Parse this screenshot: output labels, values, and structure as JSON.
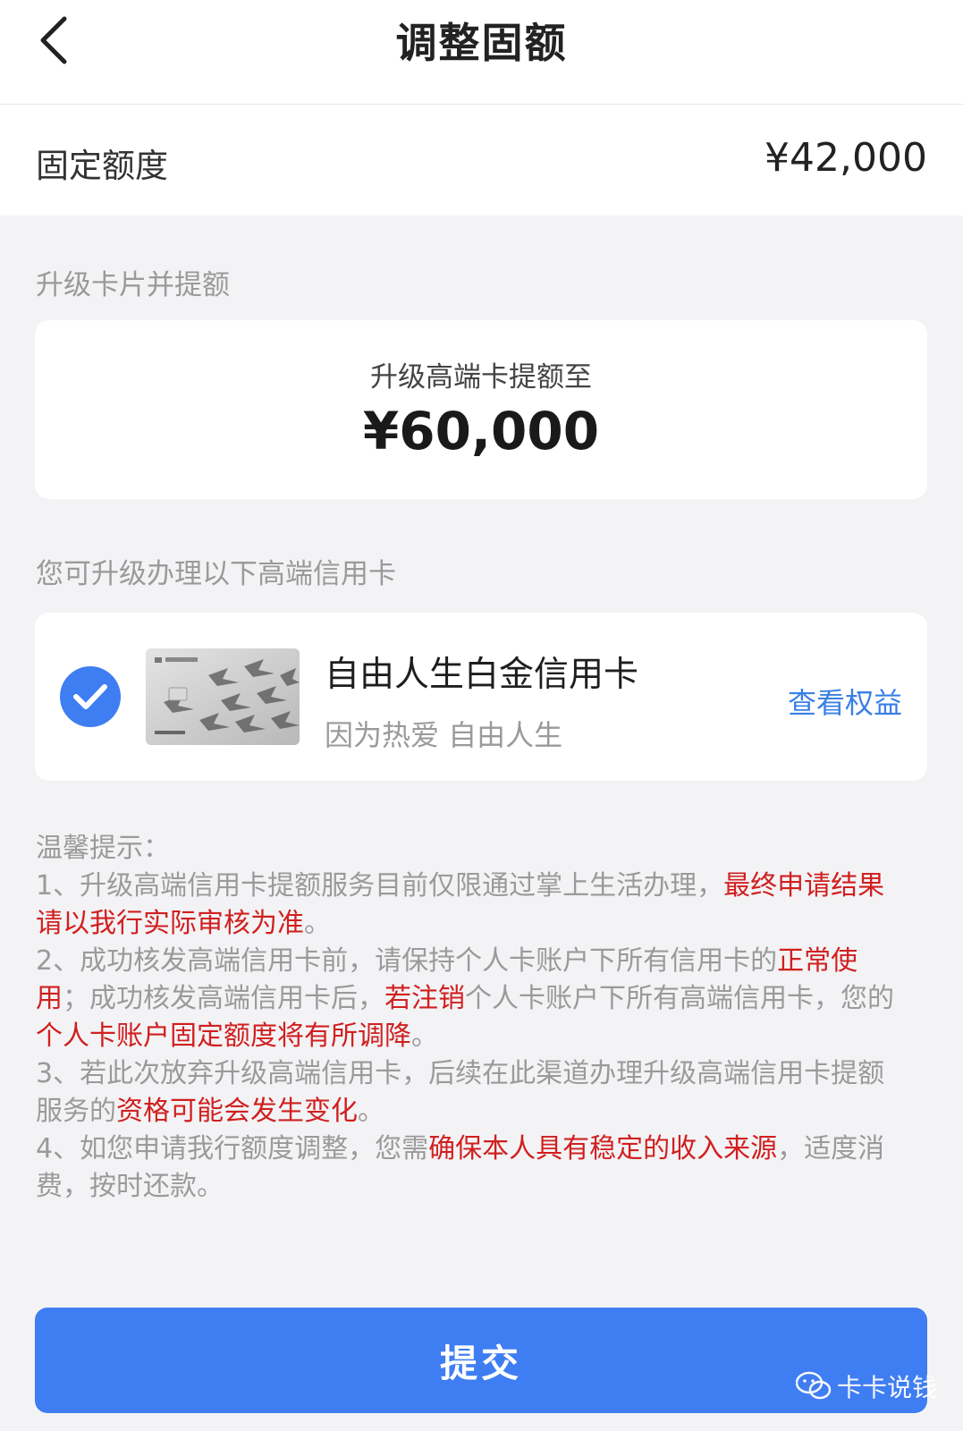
{
  "header": {
    "title": "调整固额"
  },
  "fixed_limit": {
    "label": "固定额度",
    "value": "¥42,000"
  },
  "upgrade_section": {
    "title": "升级卡片并提额",
    "caption": "升级高端卡提额至",
    "amount": "¥60,000"
  },
  "cards_section": {
    "title": "您可升级办理以下高端信用卡",
    "card": {
      "name": "自由人生白金信用卡",
      "slogan": "因为热爱 自由人生",
      "benefits_link": "查看权益",
      "selected": true
    }
  },
  "tips": {
    "heading": "温馨提示：",
    "t1a": "1、升级高端信用卡提额服务目前仅限通过掌上生活办理，",
    "t1b": "最终申请结果请以我行实际审核为准",
    "t1c": "。",
    "t2a": "2、成功核发高端信用卡前，请保持个人卡账户下所有信用卡的",
    "t2b": "正常使用",
    "t2c": "；成功核发高端信用卡后，",
    "t2d": "若注销",
    "t2e": "个人卡账户下所有高端信用卡，您的",
    "t2f": "个人卡账户固定额度将有所调降",
    "t2g": "。",
    "t3a": "3、若此次放弃升级高端信用卡，后续在此渠道办理升级高端信用卡提额服务的",
    "t3b": "资格可能会发生变化",
    "t3c": "。",
    "t4a": "4、如您申请我行额度调整，您需",
    "t4b": "确保本人具有稳定的收入来源",
    "t4c": "，适度消费，按时还款。"
  },
  "submit": {
    "label": "提交"
  },
  "watermark": {
    "text": "卡卡说钱"
  },
  "colors": {
    "accent": "#3f7df2",
    "warning": "#d11f1f",
    "link": "#3a7fe6"
  }
}
